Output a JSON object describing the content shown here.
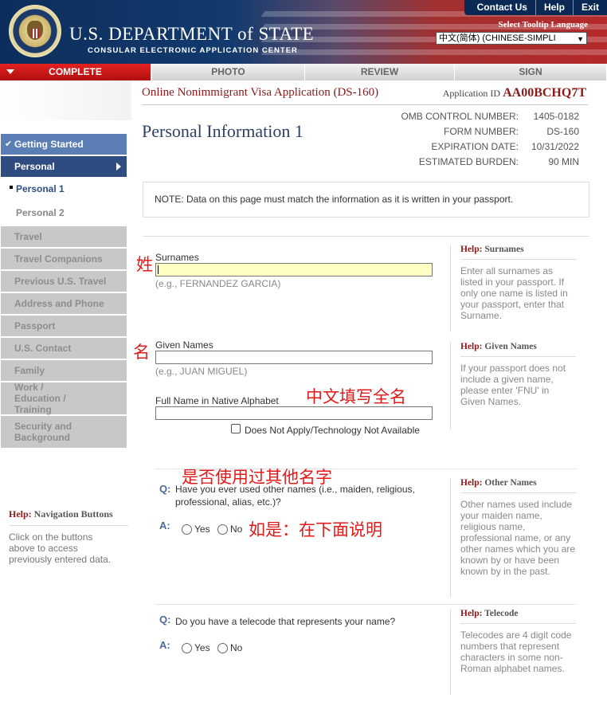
{
  "header": {
    "dept_title": "U.S. DEPARTMENT of STATE",
    "dept_subtitle": "CONSULAR ELECTRONIC APPLICATION CENTER",
    "top_links": [
      "Contact Us",
      "Help",
      "Exit"
    ],
    "tooltip_label": "Select Tooltip Language",
    "language_selected": "中文(简体) (CHINESE-SIMPLI"
  },
  "tabs": [
    {
      "label": "COMPLETE",
      "active": true
    },
    {
      "label": "PHOTO",
      "active": false
    },
    {
      "label": "REVIEW",
      "active": false
    },
    {
      "label": "SIGN",
      "active": false
    }
  ],
  "nav": {
    "getting_started": "Getting Started",
    "personal": "Personal",
    "personal_1": "Personal 1",
    "personal_2": "Personal 2",
    "travel": "Travel",
    "travel_companions": "Travel Companions",
    "previous_us_travel": "Previous U.S. Travel",
    "address_phone": "Address and Phone",
    "passport": "Passport",
    "us_contact": "U.S. Contact",
    "family": "Family",
    "work_education": "Work / Education / Training",
    "security": "Security and Background",
    "help_title_prefix": "Help:",
    "help_title": "Navigation Buttons",
    "help_text": "Click on the buttons above to access previously entered data."
  },
  "main": {
    "app_title": "Online Nonimmigrant Visa Application (DS-160)",
    "app_id_label": "Application ID",
    "app_id_value": "AA00BCHQ7T",
    "page_title": "Personal Information 1",
    "omb": [
      {
        "k": "OMB CONTROL NUMBER:",
        "v": "1405-0182"
      },
      {
        "k": "FORM NUMBER:",
        "v": "DS-160"
      },
      {
        "k": "EXPIRATION DATE:",
        "v": "10/31/2022"
      },
      {
        "k": "ESTIMATED BURDEN:",
        "v": "90 MIN"
      }
    ],
    "note": "NOTE: Data on this page must match the information as it is written in your passport."
  },
  "form": {
    "surnames_label": "Surnames",
    "surnames_example": "(e.g., FERNANDEZ GARCIA)",
    "given_label": "Given Names",
    "given_example": "(e.g., JUAN MIGUEL)",
    "native_label": "Full Name in Native Alphabet",
    "native_na": "Does Not Apply/Technology Not Available",
    "q_mark": "Q:",
    "a_mark": "A:",
    "other_names_q": "Have you ever used other names (i.e., maiden, religious, professional, alias, etc.)?",
    "telecode_q": "Do you have a telecode that represents your name?",
    "yes": "Yes",
    "no": "No"
  },
  "help": {
    "prefix": "Help:",
    "surnames_title": "Surnames",
    "surnames_text": "Enter all surnames as listed in your passport. If only one name is listed in your passport, enter that Surname.",
    "given_title": "Given Names",
    "given_text": "If your passport does not include a given name, please enter 'FNU' in Given Names.",
    "other_title": "Other Names",
    "other_text": "Other names used include your maiden name, religious name, professional name, or any other names which you are known by or have been known by in the past.",
    "telecode_title": "Telecode",
    "telecode_text": "Telecodes are 4 digit code numbers that represent characters in some non-Roman alphabet names."
  },
  "annotations": {
    "surname": "姓",
    "given": "名",
    "native": "中文填写全名",
    "other_names": "是否使用过其他名字",
    "if_yes": "如是：在下面说明"
  },
  "colors": {
    "accent_red": "#8b1a1a",
    "nav_blue": "#2f4c80",
    "annotation_red": "#e31a1a"
  }
}
